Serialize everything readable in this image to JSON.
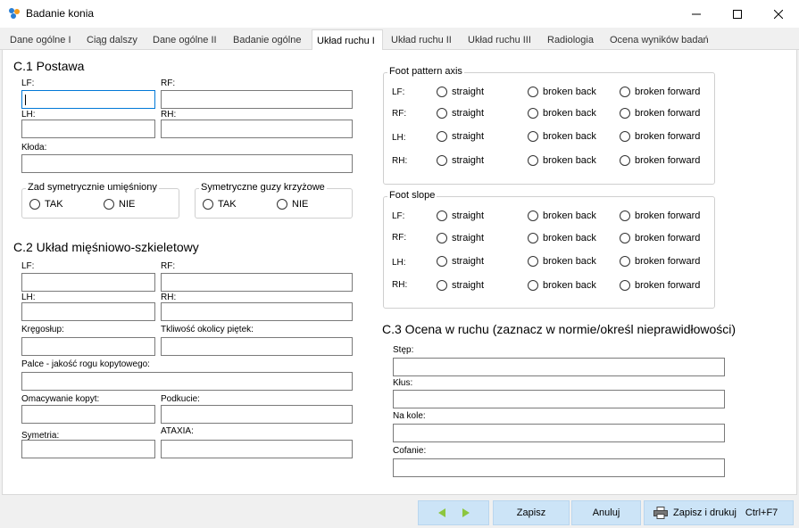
{
  "window": {
    "title": "Badanie konia"
  },
  "tabs": [
    {
      "label": "Dane ogólne I"
    },
    {
      "label": "Ciąg dalszy"
    },
    {
      "label": "Dane ogólne II"
    },
    {
      "label": "Badanie ogólne"
    },
    {
      "label": "Układ ruchu I"
    },
    {
      "label": "Układ ruchu II"
    },
    {
      "label": "Układ ruchu III"
    },
    {
      "label": "Radiologia"
    },
    {
      "label": "Ocena wyników badań"
    }
  ],
  "active_tab": "Układ ruchu I",
  "c1": {
    "title": "C.1  Postawa",
    "lf": "LF:",
    "rf": "RF:",
    "lh": "LH:",
    "rh": "RH:",
    "kloda": "Kłoda:",
    "zad": {
      "legend": "Zad symetrycznie umięśniony",
      "tak": "TAK",
      "nie": "NIE"
    },
    "guzy": {
      "legend": "Symetryczne guzy krzyżowe",
      "tak": "TAK",
      "nie": "NIE"
    }
  },
  "c2": {
    "title": "C.2 Układ  mięśniowo-szkieletowy",
    "lf": "LF:",
    "rf": "RF:",
    "lh": "LH:",
    "rh": "RH:",
    "kregoslup": "Kręgosłup:",
    "tkliwosc": "Tkliwość okolicy piętek:",
    "palce": "Palce - jakość rogu kopytowego:",
    "omacywanie": "Omacywanie kopyt:",
    "podkucie": "Podkucie:",
    "symetria": "Symetria:",
    "ataxia": "ATAXIA:"
  },
  "foot_pattern": {
    "legend": "Foot pattern axis",
    "rows": [
      {
        "label": "LF:",
        "opt1": "straight",
        "opt2": "broken back",
        "opt3": "broken forward"
      },
      {
        "label": "RF:",
        "opt1": "straight",
        "opt2": "broken back",
        "opt3": "broken forward"
      },
      {
        "label": "LH:",
        "opt1": "straight",
        "opt2": "broken back",
        "opt3": "broken forward"
      },
      {
        "label": "RH:",
        "opt1": "straight",
        "opt2": "broken back",
        "opt3": "broken forward"
      }
    ]
  },
  "foot_slope": {
    "legend": "Foot slope",
    "rows": [
      {
        "label": "LF:",
        "opt1": "straight",
        "opt2": "broken back",
        "opt3": "broken forward"
      },
      {
        "label": "RF:",
        "opt1": "straight",
        "opt2": "broken back",
        "opt3": "broken forward"
      },
      {
        "label": "LH:",
        "opt1": "straight",
        "opt2": "broken back",
        "opt3": "broken forward"
      },
      {
        "label": "RH:",
        "opt1": "straight",
        "opt2": "broken back",
        "opt3": "broken forward"
      }
    ]
  },
  "c3": {
    "title": "C.3 Ocena w ruchu (zaznacz w normie/określ nieprawidłowości)",
    "stęp": "Stęp:",
    "klus": "Kłus:",
    "na_kole": "Na kole:",
    "cofanie": "Cofanie:"
  },
  "buttons": {
    "zapisz": "Zapisz",
    "anuluj": "Anuluj",
    "zapisz_drukuj": "Zapisz i drukuj",
    "shortcut": "Ctrl+F7"
  },
  "colors": {
    "accent": "#0078d7",
    "button_bg": "#cce4f7",
    "arrow": "#8cc63f"
  }
}
